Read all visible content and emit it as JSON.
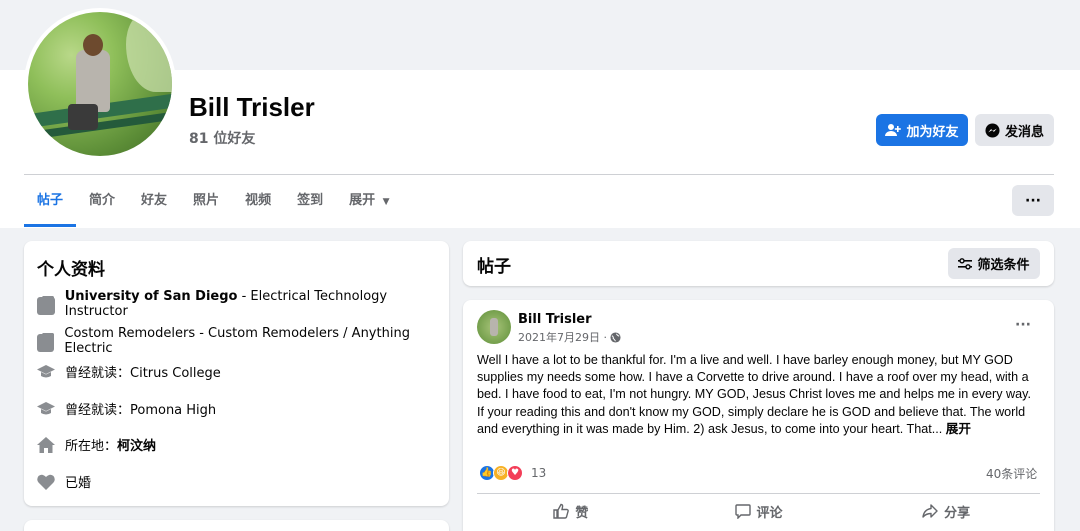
{
  "profile": {
    "name": "Bill Trisler",
    "friends_count": "81 位好友",
    "add_friend_label": "加为好友",
    "message_label": "发消息"
  },
  "tabs": [
    {
      "label": "帖子",
      "active": true
    },
    {
      "label": "简介"
    },
    {
      "label": "好友"
    },
    {
      "label": "照片"
    },
    {
      "label": "视频"
    },
    {
      "label": "签到"
    },
    {
      "label": "展开"
    }
  ],
  "more_label": "···",
  "intro": {
    "title": "个人资料",
    "rows": [
      {
        "icon": "briefcase-icon",
        "bold": "University of San Diego",
        "text": " - Electrical Technology Instructor"
      },
      {
        "icon": "briefcase-icon",
        "bold": "",
        "text": "Costom Remodelers - Custom Remodelers / Anything Electric"
      },
      {
        "icon": "graduation-cap-icon",
        "bold": "",
        "text": "曾经就读：Citrus College"
      },
      {
        "icon": "graduation-cap-icon",
        "bold": "",
        "text": "曾经就读：Pomona High"
      },
      {
        "icon": "home-icon",
        "prefix": "所在地：",
        "bold": "柯汶纳",
        "text": ""
      },
      {
        "icon": "heart-icon",
        "bold": "",
        "text": "已婚"
      }
    ]
  },
  "posts_header": {
    "title": "帖子",
    "filter_label": "筛选条件"
  },
  "post": {
    "author": "Bill Trisler",
    "date": "2021年7月29日 ·",
    "paragraph1": "Well I have a lot to be thankful for.  I'm a live and well.  I have barley enough money, but MY GOD supplies my needs some how.  I have a Corvette to drive around. I have a roof over my head, with a bed.  I have food to eat, I'm not hungry.  MY GOD, Jesus Christ loves me and helps me in every way.",
    "paragraph2": "If your reading this and don't know my GOD, simply declare he is GOD and believe that.  The world and everything in it was made by Him.  2) ask Jesus, to come into your heart.  That...",
    "see_more": "展开",
    "reaction_count": "13",
    "comments": "40条评论",
    "like_label": "赞",
    "comment_label": "评论",
    "share_label": "分享"
  },
  "colors": {
    "accent": "#1b74e4",
    "background": "#f0f2f5",
    "secondary_text": "#65676b"
  }
}
